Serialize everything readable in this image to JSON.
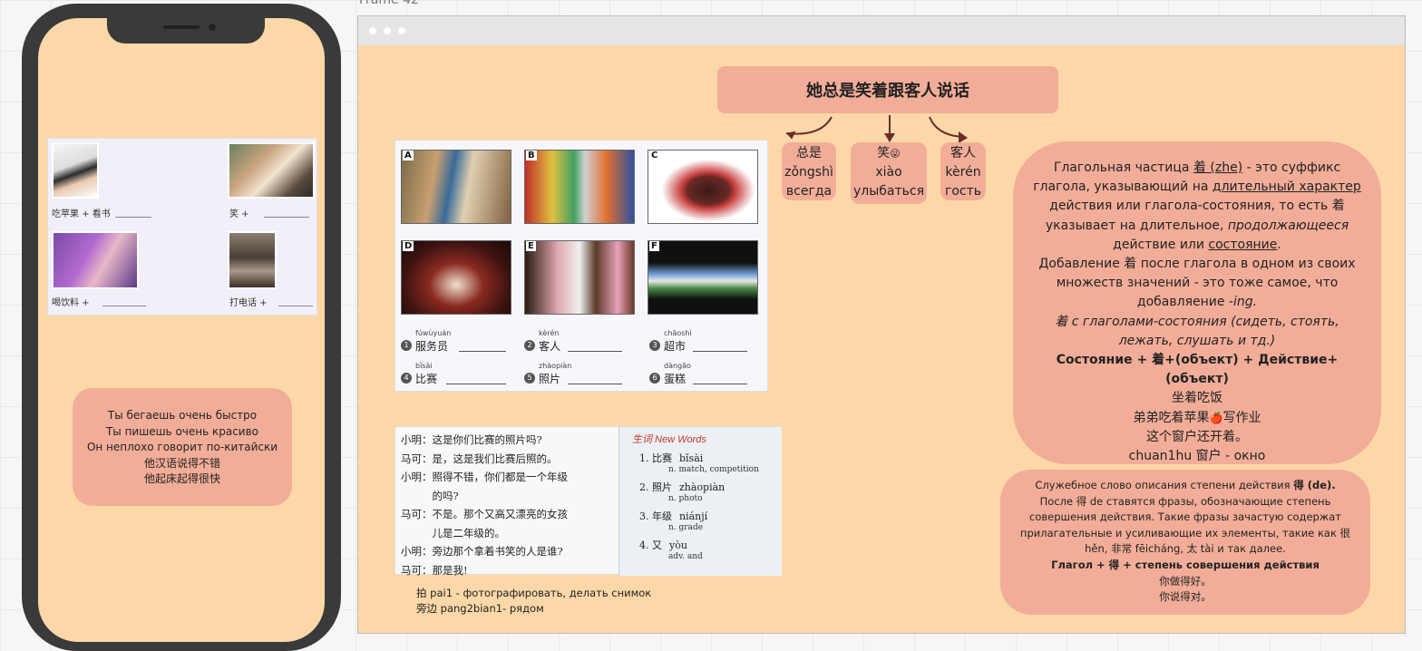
{
  "frame_label": "Frame 42",
  "phone": {
    "workbook": {
      "labels": [
        "吃苹果 + 看书",
        "笑 +",
        "喝饮料 +",
        "打电话 +"
      ]
    },
    "sentences": [
      "Ты бегаешь очень быстро",
      "Ты пишешь очень красиво",
      "Он неплохо говорит по-китайски",
      "他汉语说得不错",
      "他起床起得很快"
    ]
  },
  "main": {
    "title": "她总是笑着跟客人说话",
    "vocab": [
      {
        "hanzi": "总是",
        "pinyin": "zǒngshì",
        "meaning": "всегда"
      },
      {
        "hanzi": "笑",
        "emoji": "😜",
        "pinyin": "xiào",
        "meaning": "улыбаться"
      },
      {
        "hanzi": "客人",
        "pinyin": "kèrén",
        "meaning": "гость"
      }
    ],
    "pictures": {
      "letters": [
        "A",
        "B",
        "C",
        "D",
        "E",
        "F"
      ],
      "words": [
        {
          "num": "1",
          "pinyin": "fúwùyuán",
          "hanzi": "服务员"
        },
        {
          "num": "2",
          "pinyin": "kèrén",
          "hanzi": "客人"
        },
        {
          "num": "3",
          "pinyin": "chāoshì",
          "hanzi": "超市"
        },
        {
          "num": "4",
          "pinyin": "bǐsài",
          "hanzi": "比赛"
        },
        {
          "num": "5",
          "pinyin": "zhàopiàn",
          "hanzi": "照片"
        },
        {
          "num": "6",
          "pinyin": "dàngāo",
          "hanzi": "蛋糕"
        }
      ]
    },
    "dialog": {
      "lines": [
        "小明：这是你们比赛的照片吗?",
        "马可：是，这是我们比赛后照的。",
        "小明：照得不错，你们都是一个年级",
        "　　　的吗?",
        "马可：不是。那个又高又漂亮的女孩",
        "　　　儿是二年级的。",
        "小明：旁边那个拿着书笑的人是谁?",
        "马可：那是我!"
      ],
      "new_words_header": "生词 New Words",
      "new_words": [
        {
          "num_hanzi": "1. 比赛",
          "pinyin": "bǐsài",
          "gloss": "n. match, competition"
        },
        {
          "num_hanzi": "2. 照片",
          "pinyin": "zhàopiàn",
          "gloss": "n. photo"
        },
        {
          "num_hanzi": "3. 年级",
          "pinyin": "niánjí",
          "gloss": "n. grade"
        },
        {
          "num_hanzi": "4. 又",
          "pinyin": "yòu",
          "gloss": "adv. and"
        }
      ]
    },
    "foot_notes": [
      "拍 pai1 - фотографировать, делать снимок",
      "旁边 pang2bian1- рядом"
    ],
    "grammar": {
      "p1_a": "Глагольная частица ",
      "p1_u1": "着 (zhe)",
      "p1_b": " - это суффикс глагола, указывающий на ",
      "p1_u2": "длительный характер",
      "p1_c": " действия или глагола-состояния, то есть 着 указывает на длительное, ",
      "p1_i": "продолжающееся",
      "p1_d": " действие или ",
      "p1_u3": "состояние",
      "p1_e": ".",
      "p2_a": "Добавление 着 после глагола в одном из своих множеств значений - это тоже самое, что добавляение ",
      "p2_i": "-ing.",
      "p3": "着 с глаголами-состояния (сидеть, стоять, лежать, слушать и тд.)",
      "formula": "Состояние + 着+(объект) + Действие+(объект)",
      "ex1": "坐着吃饭",
      "ex2_a": "弟弟吃着苹果",
      "ex2_emoji": "🍎",
      "ex2_b": "写作业",
      "ex3": "这个窗户还开着。",
      "ex4": "chuan1hu 窗户 - окно"
    },
    "de": {
      "l1_a": "Служебное слово описания степени действия ",
      "l1_b": "得 (de).",
      "l2": "После 得 de ставятся фразы, обозначающие степень совершения действия. Такие фразы зачастую содержат прилагательные и усиливающие их элементы, такие как 很 hěn, 非常 fēicháng, 太 tài и так далее.",
      "formula": "Глагол + 得 + степень совершения действия",
      "ex1": "你做得好。",
      "ex2": "你说得对。"
    }
  },
  "colors": {
    "canvas_bg": "#f6f6f6",
    "frame_bg": "#fcd8a8",
    "box_bg": "#f2ad98",
    "phone_body": "#3a3a3a",
    "arrow": "#6b2b2b"
  }
}
